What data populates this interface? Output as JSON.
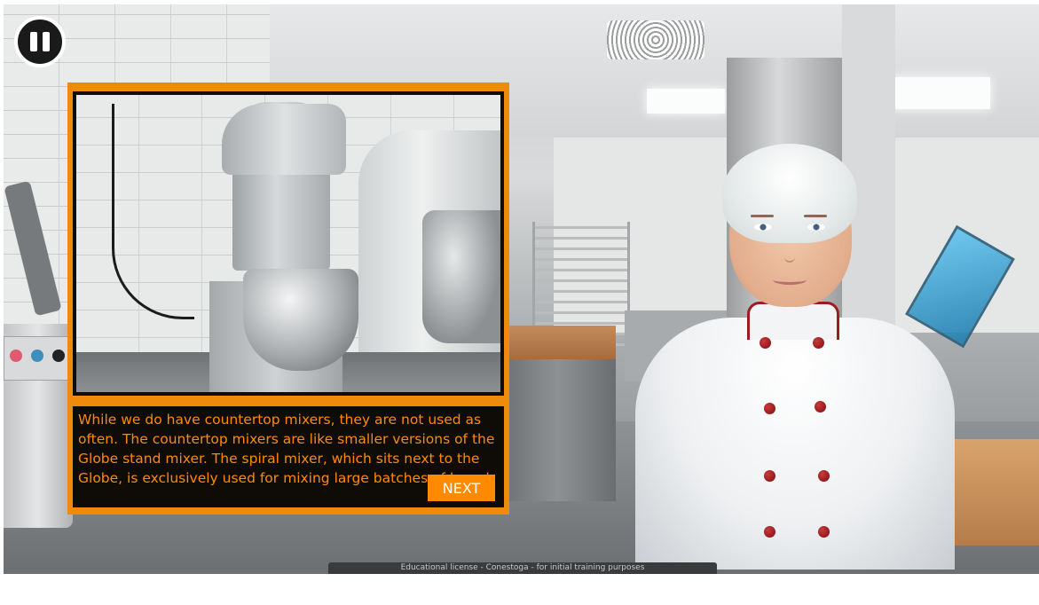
{
  "controls": {
    "pause_label": "Pause"
  },
  "dialog": {
    "caption": "While we do have countertop mixers, they are not used as often. The countertop mixers are like smaller versions of the Globe stand mixer. The spiral mixer, which sits next to the Globe, is exclusively used for mixing large batches of bread.",
    "next_label": "NEXT"
  },
  "footer": {
    "license_text": "Educational license - Conestoga - for initial training purposes"
  },
  "colors": {
    "accent_orange": "#f08a0b",
    "caption_text": "#ff8a00",
    "caption_background": "#0f0c08",
    "pause_button": "#1a1a1a",
    "coat_buttons": "#9c1c24"
  },
  "icons": {
    "pause": "pause-icon"
  }
}
